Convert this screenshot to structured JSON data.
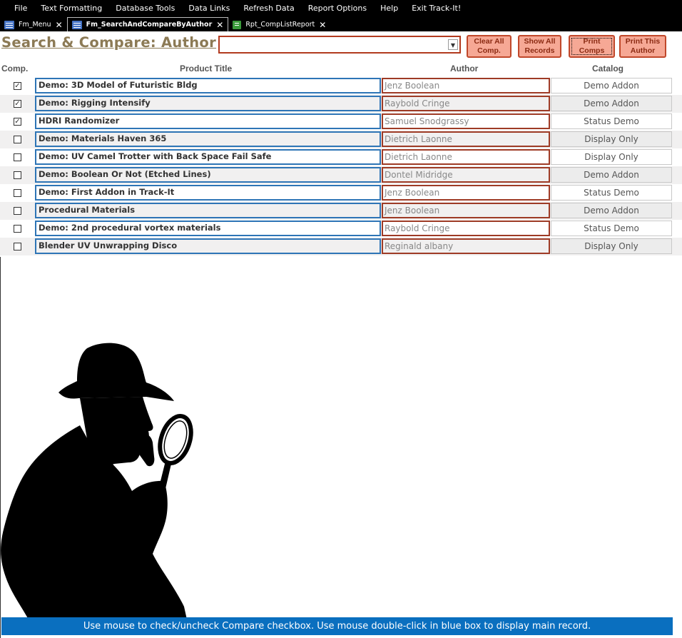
{
  "menu": [
    "File",
    "Text Formatting",
    "Database Tools",
    "Data Links",
    "Refresh Data",
    "Report Options",
    "Help",
    "Exit Track-It!"
  ],
  "tabs": [
    {
      "label": "Fm_Menu",
      "icon": "form-icon",
      "active": false
    },
    {
      "label": "Fm_SearchAndCompareByAuthor",
      "icon": "form-icon",
      "active": true
    },
    {
      "label": "Rpt_CompListReport",
      "icon": "report-icon",
      "active": false
    }
  ],
  "form_title": "Search & Compare: Author",
  "author_combo": {
    "value": ""
  },
  "buttons": {
    "clear_all": "Clear All Comp.",
    "show_all": "Show All Records",
    "print_comps": "Print Comps",
    "print_author": "Print This Author"
  },
  "headers": {
    "comp": "Comp.",
    "title": "Product Title",
    "author": "Author",
    "catalog": "Catalog"
  },
  "rows": [
    {
      "checked": true,
      "title": "Demo: 3D Model of Futuristic Bldg",
      "author": "Jenz Boolean",
      "catalog": "Demo Addon"
    },
    {
      "checked": true,
      "title": "Demo: Rigging Intensify",
      "author": "Raybold Cringe",
      "catalog": "Demo Addon"
    },
    {
      "checked": true,
      "title": "HDRI Randomizer",
      "author": "Samuel Snodgrassy",
      "catalog": "Status Demo"
    },
    {
      "checked": false,
      "title": "Demo: Materials Haven 365",
      "author": "Dietrich Laonne",
      "catalog": "Display Only"
    },
    {
      "checked": false,
      "title": "Demo: UV Camel Trotter with Back Space Fail Safe",
      "author": "Dietrich Laonne",
      "catalog": "Display Only"
    },
    {
      "checked": false,
      "title": "Demo: Boolean Or Not (Etched Lines)",
      "author": "Dontel Midridge",
      "catalog": "Demo Addon"
    },
    {
      "checked": false,
      "title": "Demo: First Addon in Track-It",
      "author": "Jenz Boolean",
      "catalog": "Status Demo"
    },
    {
      "checked": false,
      "title": "Procedural Materials",
      "author": "Jenz Boolean",
      "catalog": "Demo Addon"
    },
    {
      "checked": false,
      "title": "Demo: 2nd procedural vortex materials",
      "author": "Raybold Cringe",
      "catalog": "Status Demo"
    },
    {
      "checked": false,
      "title": "Blender UV Unwrapping Disco",
      "author": "Reginald albany",
      "catalog": "Display Only"
    }
  ],
  "status_text": "Use mouse to check/uncheck Compare checkbox. Use mouse double-click in blue box to display main record.",
  "colors": {
    "accent_blue": "#2e75b6",
    "accent_red": "#9e3b26",
    "button_fill": "#f6a895",
    "status_bar": "#0a6fbf",
    "title_color": "#8c7a55"
  }
}
